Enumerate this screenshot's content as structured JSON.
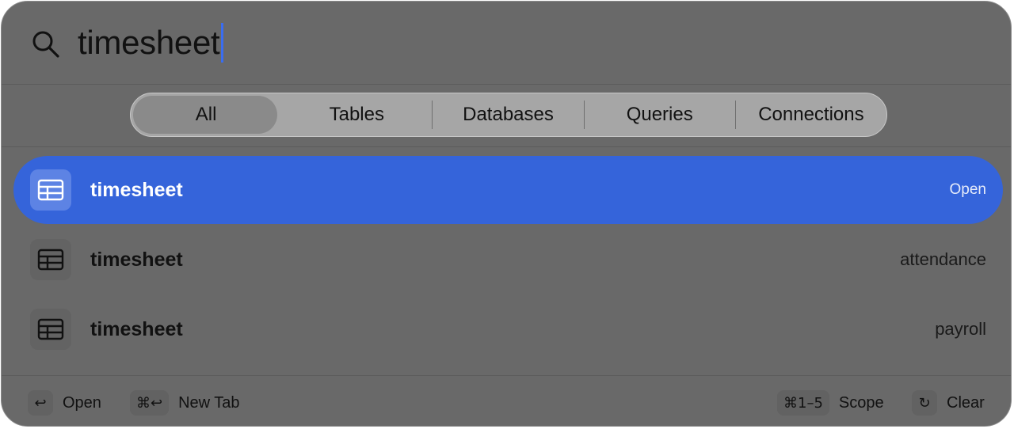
{
  "search": {
    "query": "timesheet",
    "icon": "search-icon"
  },
  "scopes": [
    {
      "label": "All",
      "selected": true
    },
    {
      "label": "Tables",
      "selected": false
    },
    {
      "label": "Databases",
      "selected": false
    },
    {
      "label": "Queries",
      "selected": false
    },
    {
      "label": "Connections",
      "selected": false
    }
  ],
  "results": [
    {
      "title": "timesheet",
      "meta": "Open",
      "icon": "table-icon",
      "selected": true
    },
    {
      "title": "timesheet",
      "meta": "attendance",
      "icon": "table-icon",
      "selected": false
    },
    {
      "title": "timesheet",
      "meta": "payroll",
      "icon": "table-icon",
      "selected": false
    }
  ],
  "footer": {
    "open": {
      "key": "↩",
      "label": "Open"
    },
    "new_tab": {
      "key": "⌘↩",
      "label": "New Tab"
    },
    "scope": {
      "key": "⌘1–5",
      "label": "Scope"
    },
    "clear": {
      "key": "↻",
      "label": "Clear"
    }
  },
  "colors": {
    "panel": "#696969",
    "selected_row": "#3564da",
    "caret": "#3a6df0",
    "segmented_bg": "#a6a6a6"
  }
}
